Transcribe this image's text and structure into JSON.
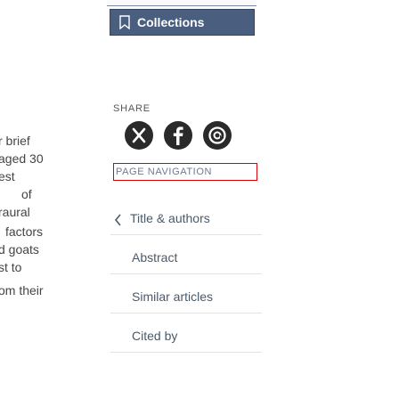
{
  "left_fragment": [
    "r brief",
    "aged 30",
    "est",
    "of",
    "raural",
    "factors",
    "d goats",
    "st to",
    "om their"
  ],
  "collections": {
    "label": "Collections"
  },
  "share": {
    "label": "SHARE",
    "buttons": [
      "twitter",
      "facebook",
      "email"
    ]
  },
  "page_navigation": {
    "label": "PAGE NAVIGATION",
    "items": [
      {
        "label": "Title & authors"
      },
      {
        "label": "Abstract"
      },
      {
        "label": "Similar articles"
      },
      {
        "label": "Cited by"
      }
    ]
  },
  "colors": {
    "button_bg": "#4a5f80",
    "accent": "#dd0000"
  }
}
